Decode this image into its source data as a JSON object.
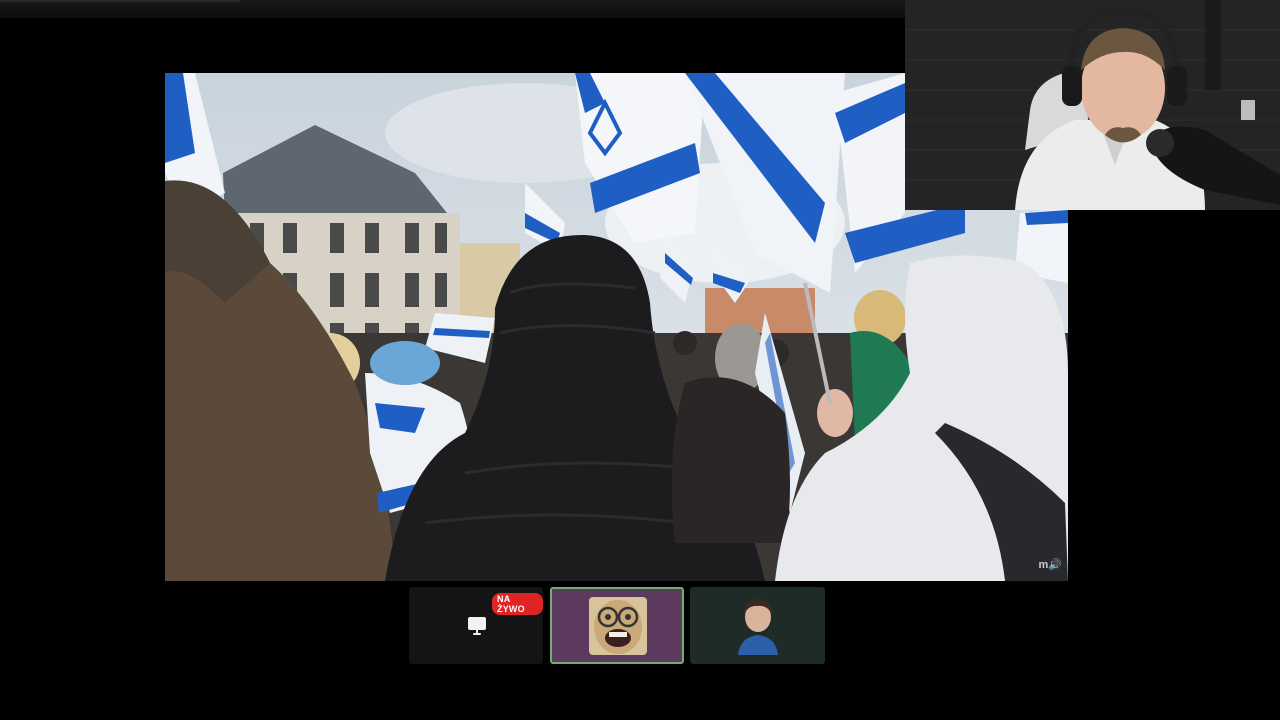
{
  "stream": {
    "live_badge": "NA ŻYWO",
    "watermark": "m🔊"
  },
  "tiles": [
    {
      "kind": "screen-share",
      "icon": "monitor-icon",
      "live": true
    },
    {
      "kind": "avatar",
      "icon": "cartoon-face-avatar",
      "active": true
    },
    {
      "kind": "camera",
      "icon": "person-thumbnail"
    }
  ],
  "colors": {
    "live": "#e02424",
    "active_border": "#6fb06e",
    "flag_blue": "#1f5fc4"
  }
}
